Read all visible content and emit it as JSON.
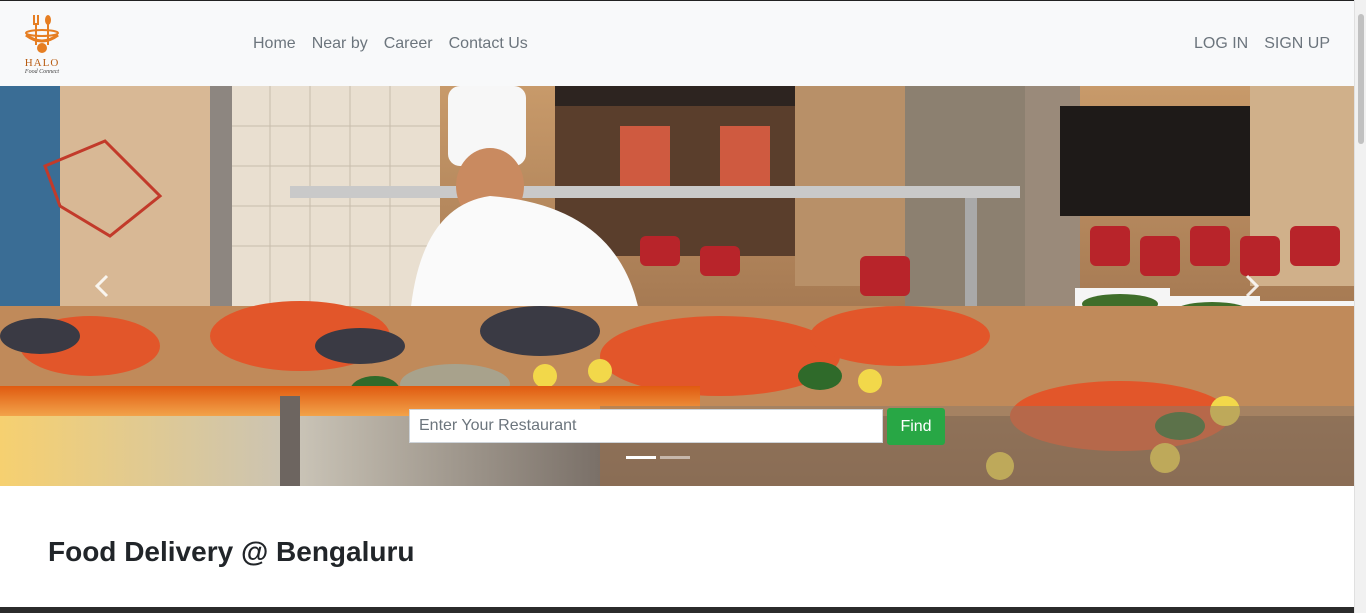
{
  "brand": {
    "name": "HALO",
    "tagline": "Food Connect",
    "color": "#e67e22"
  },
  "nav": {
    "links": [
      {
        "label": "Home"
      },
      {
        "label": "Near by"
      },
      {
        "label": "Career"
      },
      {
        "label": "Contact Us"
      }
    ],
    "auth": {
      "login": "LOG IN",
      "signup": "SIGN UP"
    }
  },
  "hero": {
    "search_placeholder": "Enter Your Restaurant",
    "find_label": "Find",
    "slide_count": 2,
    "active_slide": 1,
    "prev_icon": "chevron-left-icon",
    "next_icon": "chevron-right-icon"
  },
  "main": {
    "section_title": "Food Delivery @ Bengaluru"
  },
  "colors": {
    "find_button": "#28a745",
    "navbar_bg": "#f8f9fa",
    "nav_text": "#6c757d"
  }
}
